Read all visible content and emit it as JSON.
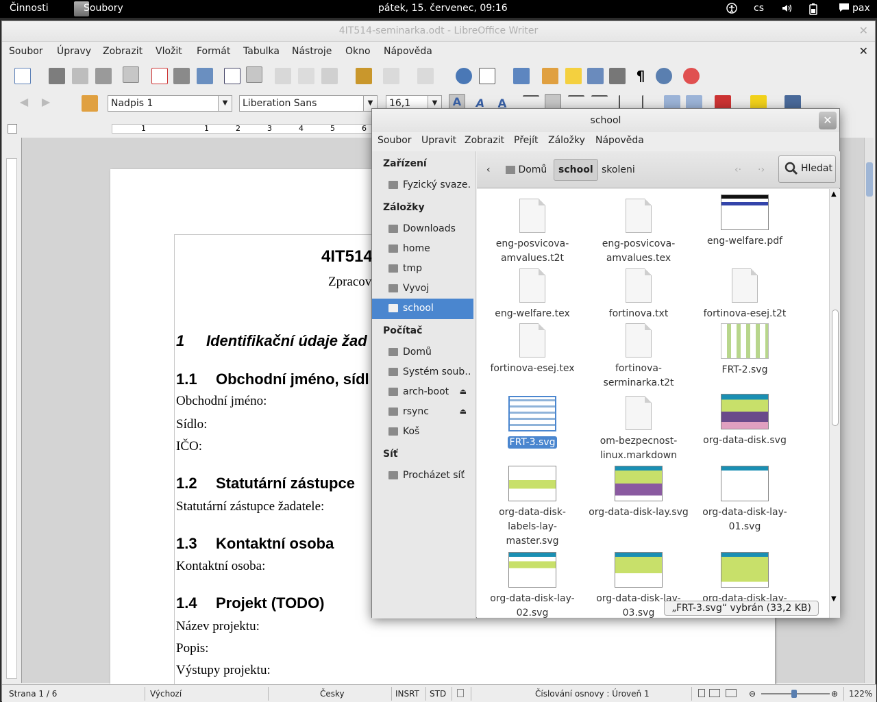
{
  "topbar": {
    "activities": "Činnosti",
    "app": "Soubory",
    "clock": "pátek, 15. červenec, 09:16",
    "keyboard": "cs",
    "user": "pax"
  },
  "writer": {
    "window_title": "4IT514-seminarka.odt - LibreOffice Writer",
    "menu": [
      "Soubor",
      "Úpravy",
      "Zobrazit",
      "Vložit",
      "Formát",
      "Tabulka",
      "Nástroje",
      "Okno",
      "Nápověda"
    ],
    "paragraph_style": "Nadpis 1",
    "font_name": "Liberation Sans",
    "font_size": "16,1",
    "document": {
      "title": "4IT514",
      "subtitle": "Zpracov",
      "h1_num": "1",
      "h1": "Identifikační údaje žad",
      "s11_num": "1.1",
      "s11": "Obchodní jméno, sídl",
      "l_obchodni": "Obchodní jméno:",
      "l_sidlo": "Sídlo:",
      "l_ico": "IČO:",
      "s12_num": "1.2",
      "s12": "Statutární zástupce",
      "l_statutarni": "Statutární zástupce žadatele:",
      "s13_num": "1.3",
      "s13": "Kontaktní osoba",
      "l_kontaktni": "Kontaktní osoba:",
      "s14_num": "1.4",
      "s14": "Projekt (TODO)",
      "l_nazev": "Název projektu:",
      "l_popis": "Popis:",
      "l_vystupy": "Výstupy projektu:"
    },
    "status": {
      "page": "Strana 1 / 6",
      "style": "Výchozí",
      "language": "Česky",
      "insert": "INSRT",
      "selection": "STD",
      "outline": "Číslování osnovy : Úroveň 1",
      "zoom": "122%"
    }
  },
  "nautilus": {
    "title": "school",
    "menu": [
      "Soubor",
      "Upravit",
      "Zobrazit",
      "Přejít",
      "Záložky",
      "Nápověda"
    ],
    "sidebar": {
      "devices_head": "Zařízení",
      "devices": [
        "Fyzický svaze…"
      ],
      "bookmarks_head": "Záložky",
      "bookmarks": [
        "Downloads",
        "home",
        "tmp",
        "Vyvoj",
        "school"
      ],
      "computer_head": "Počítač",
      "computer": [
        "Domů",
        "Systém soub…",
        "arch-boot",
        "rsync",
        "Koš"
      ],
      "network_head": "Síť",
      "network": [
        "Procházet síť"
      ],
      "selected": "school"
    },
    "path": {
      "home": "Domů",
      "current": "school",
      "child": "skoleni",
      "search": "Hledat"
    },
    "files": [
      {
        "name": "eng-posvicova-amvalues.t2t"
      },
      {
        "name": "eng-posvicova-amvalues.tex"
      },
      {
        "name": "eng-welfare.pdf"
      },
      {
        "name": "eng-welfare.tex"
      },
      {
        "name": "fortinova.txt"
      },
      {
        "name": "fortinova-esej.t2t"
      },
      {
        "name": "fortinova-esej.tex"
      },
      {
        "name": "fortinova-serminarka.t2t"
      },
      {
        "name": "FRT-2.svg"
      },
      {
        "name": "FRT-3.svg"
      },
      {
        "name": "om-bezpecnost-linux.markdown"
      },
      {
        "name": "org-data-disk.svg"
      },
      {
        "name": "org-data-disk-labels-lay-master.svg"
      },
      {
        "name": "org-data-disk-lay.svg"
      },
      {
        "name": "org-data-disk-lay-01.svg"
      },
      {
        "name": "org-data-disk-lay-02.svg"
      },
      {
        "name": "org-data-disk-lay-03.svg"
      },
      {
        "name": "org-data-disk-lay-"
      }
    ],
    "status": "„FRT-3.svg“ vybrán (33,2 KB)"
  }
}
